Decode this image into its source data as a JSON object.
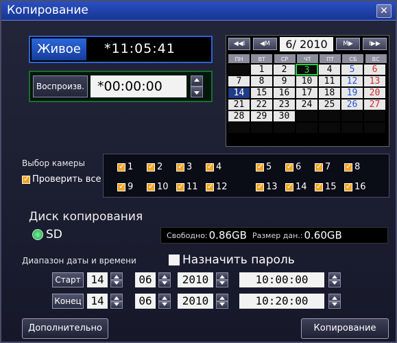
{
  "window": {
    "title": "Копирование",
    "close_glyph": "✕"
  },
  "live": {
    "label": "Живое",
    "time": "*11:05:41"
  },
  "playback": {
    "label": "Воспроизв.",
    "time": "*00:00:00"
  },
  "calendar": {
    "month_label": "6/ 2010",
    "nav": {
      "prev_year": "◀◀I",
      "prev_month": "◀M",
      "next_month": "M▶",
      "next_year": "I▶▶"
    },
    "weekdays": [
      "ПН",
      "ВТ",
      "СР",
      "ЧТ",
      "ПТ",
      "СБ",
      "ВС"
    ],
    "weeks": [
      [
        "",
        "1",
        "2",
        "3",
        "4",
        "5",
        "6"
      ],
      [
        "7",
        "8",
        "9",
        "10",
        "11",
        "12",
        "13"
      ],
      [
        "14",
        "15",
        "16",
        "17",
        "18",
        "19",
        "20"
      ],
      [
        "21",
        "22",
        "23",
        "24",
        "25",
        "26",
        "27"
      ],
      [
        "28",
        "29",
        "30",
        "",
        "",
        "",
        ""
      ],
      [
        "",
        "",
        "",
        "",
        "",
        "",
        ""
      ]
    ],
    "today": "3",
    "selected_or_recorded": [
      "14"
    ]
  },
  "camera": {
    "label": "Выбор камеры",
    "check_all": "Проверить все",
    "cameras": [
      "1",
      "2",
      "3",
      "4",
      "5",
      "6",
      "7",
      "8",
      "9",
      "10",
      "11",
      "12",
      "13",
      "14",
      "15",
      "16"
    ]
  },
  "disk": {
    "title": "Диск копирования",
    "media": "SD",
    "free_label": "Свободно:",
    "free_value": "0.86GB",
    "size_label": "Размер дан.:",
    "size_value": "0.60GB"
  },
  "range": {
    "label": "Диапазон даты и времени",
    "password": "Назначить пароль",
    "start": {
      "label": "Старт",
      "day": "14",
      "month": "06",
      "year": "2010",
      "time": "10:00:00"
    },
    "end": {
      "label": "Конец",
      "day": "14",
      "month": "06",
      "year": "2010",
      "time": "10:20:00"
    }
  },
  "buttons": {
    "advanced": "Дополнительно",
    "copy": "Копирование"
  },
  "colors": {
    "titlebar": "#2a4fc0",
    "live_border": "#2a64d6",
    "play_border": "#1a6e32",
    "check": "#f4a51f"
  }
}
